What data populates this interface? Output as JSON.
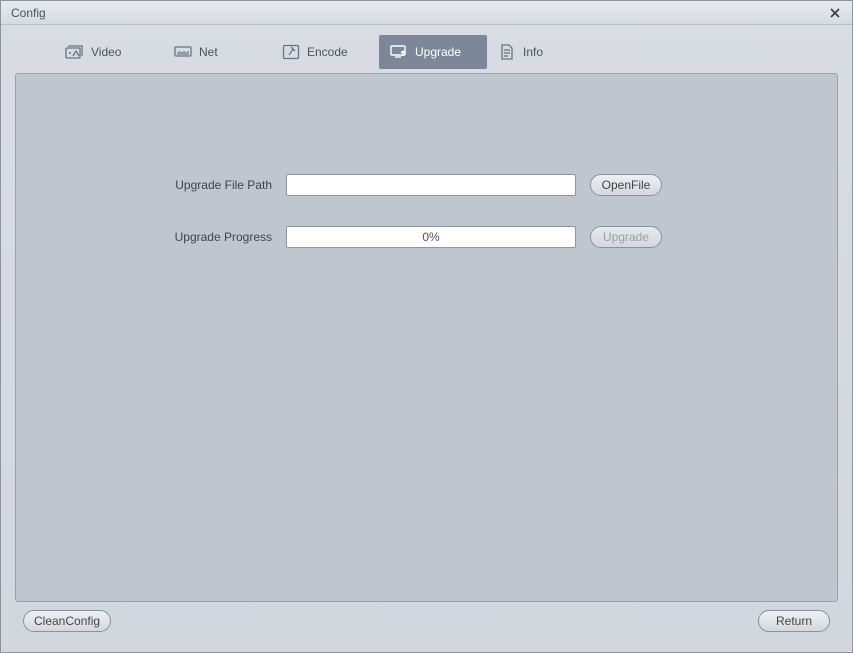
{
  "window": {
    "title": "Config"
  },
  "tabs": {
    "video": "Video",
    "net": "Net",
    "encode": "Encode",
    "upgrade": "Upgrade",
    "info": "Info",
    "active": "upgrade"
  },
  "form": {
    "file_path_label": "Upgrade File Path",
    "file_path_value": "",
    "open_file_label": "OpenFile",
    "progress_label": "Upgrade Progress",
    "progress_text": "0%",
    "upgrade_btn_label": "Upgrade"
  },
  "footer": {
    "clean_label": "CleanConfig",
    "return_label": "Return"
  }
}
